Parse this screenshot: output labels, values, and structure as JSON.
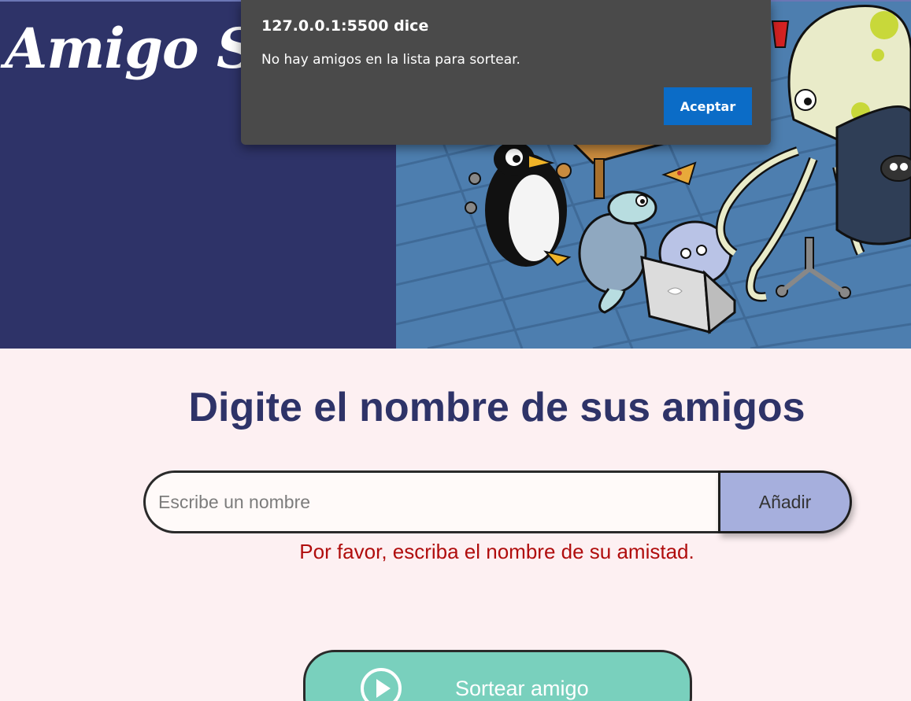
{
  "header": {
    "app_title": "Amigo Secreto",
    "image_icon": "cartoon-illustration"
  },
  "main": {
    "heading": "Digite el nombre de sus amigos",
    "input": {
      "placeholder": "Escribe un nombre",
      "value": ""
    },
    "add_button_label": "Añadir",
    "error_text": "Por favor, escriba el nombre de su amistad.",
    "draw_button": {
      "label": "Sortear amigo",
      "icon": "play-circle-icon"
    }
  },
  "alert": {
    "title": "127.0.0.1:5500 dice",
    "message": "No hay amigos en la lista para sortear.",
    "ok_label": "Aceptar"
  },
  "colors": {
    "header_bg": "#2e3368",
    "page_bg": "#fdf0f2",
    "heading": "#2e3368",
    "add_button": "#a6afdd",
    "draw_button": "#79d0bd",
    "error": "#b00d0d",
    "alert_bg": "#4a4a4a",
    "alert_button": "#0b6cc7"
  }
}
